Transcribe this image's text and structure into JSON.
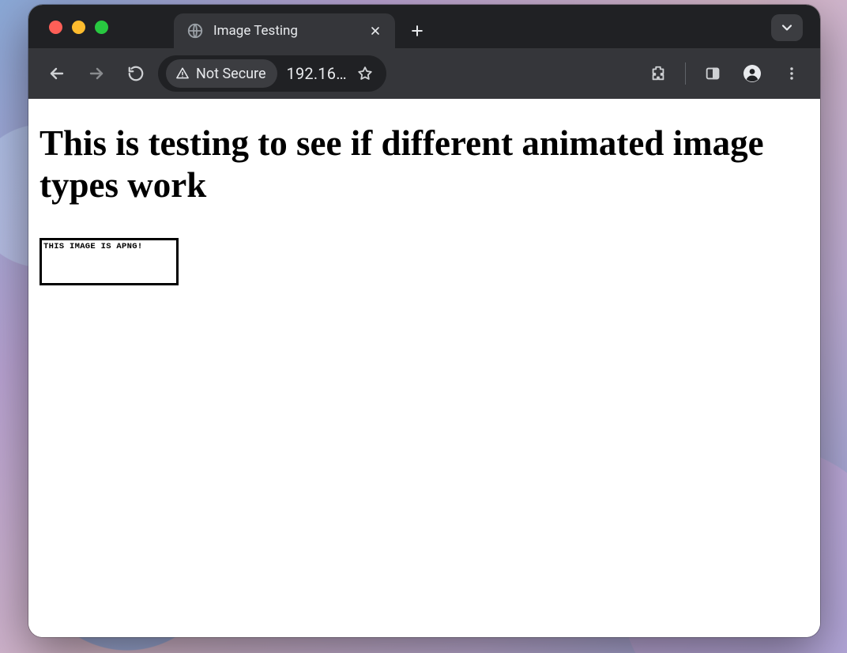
{
  "browser": {
    "tab": {
      "title": "Image Testing"
    },
    "security_label": "Not Secure",
    "url_display": "192.16…"
  },
  "page": {
    "heading": "This is testing to see if different animated image types work",
    "apng_caption": "THIS IMAGE IS APNG!"
  }
}
